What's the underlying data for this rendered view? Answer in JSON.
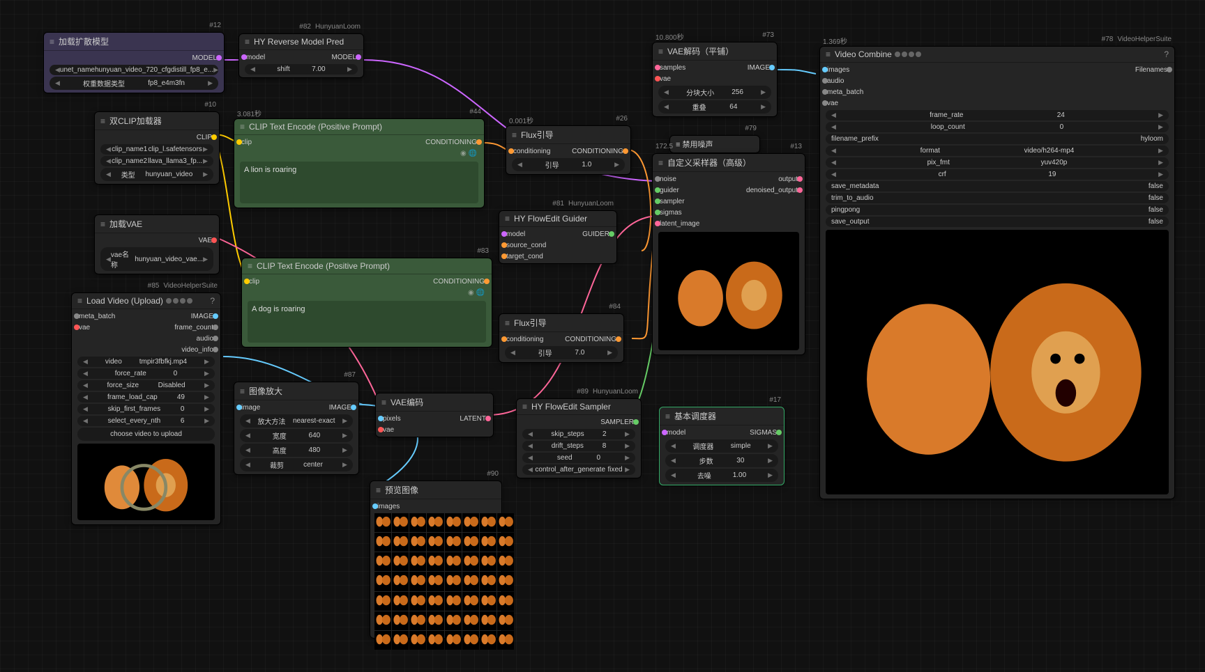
{
  "nodes": {
    "n12": {
      "id": "#12",
      "title": "加载扩散模型",
      "out": "MODEL",
      "w1_label": "unet_name",
      "w1_val": "hunyuan_video_720_cfgdistill_fp8_e...",
      "w2_label": "权重数据类型",
      "w2_val": "fp8_e4m3fn"
    },
    "n82": {
      "id": "#82",
      "tag": "HunyuanLoom",
      "title": "HY Reverse Model Pred",
      "in1": "model",
      "out1": "MODEL",
      "w1_label": "shift",
      "w1_val": "7.00"
    },
    "n73": {
      "id": "#73",
      "time": "10.800秒",
      "title": "VAE解码（平铺）",
      "in1": "samples",
      "in2": "vae",
      "out1": "IMAGE",
      "w1_label": "分块大小",
      "w1_val": "256",
      "w2_label": "重叠",
      "w2_val": "64"
    },
    "n78": {
      "id": "#78",
      "tag": "VideoHelperSuite",
      "time": "1.369秒",
      "title": "Video Combine",
      "in1": "images",
      "in2": "audio",
      "in3": "meta_batch",
      "in4": "vae",
      "out1": "Filenames",
      "rows": [
        {
          "label": "frame_rate",
          "val": "24"
        },
        {
          "label": "loop_count",
          "val": "0"
        },
        {
          "label": "filename_prefix",
          "val": "hyloom"
        },
        {
          "label": "format",
          "val": "video/h264-mp4"
        },
        {
          "label": "pix_fmt",
          "val": "yuv420p"
        },
        {
          "label": "crf",
          "val": "19"
        },
        {
          "label": "save_metadata",
          "val": "false"
        },
        {
          "label": "trim_to_audio",
          "val": "false"
        },
        {
          "label": "pingpong",
          "val": "false"
        },
        {
          "label": "save_output",
          "val": "false"
        }
      ]
    },
    "n10": {
      "id": "#10",
      "title": "双CLIP加载器",
      "out1": "CLIP",
      "rows": [
        {
          "label": "clip_name1",
          "val": "clip_l.safetensors"
        },
        {
          "label": "clip_name2",
          "val": "llava_llama3_fp..."
        },
        {
          "label": "类型",
          "val": "hunyuan_video"
        }
      ]
    },
    "n44": {
      "id": "#44",
      "time": "3.081秒",
      "title": "CLIP Text Encode (Positive Prompt)",
      "in1": "clip",
      "out1": "CONDITIONING",
      "text": "A lion is roaring"
    },
    "n83": {
      "id": "#83",
      "title": "CLIP Text Encode (Positive Prompt)",
      "in1": "clip",
      "out1": "CONDITIONING",
      "text": "A dog is roaring"
    },
    "n26": {
      "id": "#26",
      "time": "0.001秒",
      "title": "Flux引导",
      "in1": "conditioning",
      "out1": "CONDITIONING",
      "w1_label": "引导",
      "w1_val": "1.0"
    },
    "n84": {
      "id": "#84",
      "title": "Flux引导",
      "in1": "conditioning",
      "out1": "CONDITIONING",
      "w1_label": "引导",
      "w1_val": "7.0"
    },
    "n79": {
      "id": "#79",
      "title": "禁用噪声"
    },
    "n13": {
      "id": "#13",
      "time": "172.5",
      "title": "自定义采样器（高级）",
      "out1": "output",
      "out2": "denoised_output",
      "ins": [
        "noise",
        "guider",
        "sampler",
        "sigmas",
        "latent_image"
      ]
    },
    "n81": {
      "id": "#81",
      "tag": "HunyuanLoom",
      "title": "HY FlowEdit Guider",
      "out1": "GUIDER",
      "ins": [
        "model",
        "source_cond",
        "target_cond"
      ]
    },
    "n89": {
      "id": "#89",
      "tag": "HunyuanLoom",
      "title": "HY FlowEdit Sampler",
      "out1": "SAMPLER",
      "rows": [
        {
          "label": "skip_steps",
          "val": "2"
        },
        {
          "label": "drift_steps",
          "val": "8"
        },
        {
          "label": "seed",
          "val": "0"
        },
        {
          "label": "control_after_generate",
          "val": "fixed"
        }
      ]
    },
    "n17": {
      "id": "#17",
      "title": "基本调度器",
      "in1": "model",
      "out1": "SIGMAS",
      "rows": [
        {
          "label": "调度器",
          "val": "simple"
        },
        {
          "label": "步数",
          "val": "30"
        },
        {
          "label": "去噪",
          "val": "1.00"
        }
      ]
    },
    "vae_load": {
      "title": "加载VAE",
      "out1": "VAE",
      "w1_label": "vae名称",
      "w1_val": "hunyuan_video_vae..."
    },
    "n85": {
      "id": "#85",
      "tag": "VideoHelperSuite",
      "title": "Load Video (Upload)",
      "outs1": "meta_batch",
      "outs2": "vae",
      "routs": [
        "IMAGE",
        "frame_count",
        "audio",
        "video_info"
      ],
      "rows": [
        {
          "label": "video",
          "val": "tmpir3fbfkj.mp4"
        },
        {
          "label": "force_rate",
          "val": "0"
        },
        {
          "label": "force_size",
          "val": "Disabled"
        },
        {
          "label": "frame_load_cap",
          "val": "49"
        },
        {
          "label": "skip_first_frames",
          "val": "0"
        },
        {
          "label": "select_every_nth",
          "val": "6"
        }
      ],
      "choose": "choose video to upload"
    },
    "n87": {
      "id": "#87",
      "title": "图像放大",
      "in1": "image",
      "out1": "IMAGE",
      "rows": [
        {
          "label": "放大方法",
          "val": "nearest-exact"
        },
        {
          "label": "宽度",
          "val": "640"
        },
        {
          "label": "高度",
          "val": "480"
        },
        {
          "label": "裁剪",
          "val": "center"
        }
      ]
    },
    "n_vae_enc": {
      "title": "VAE编码",
      "in1": "pixels",
      "in2": "vae",
      "out1": "LATENT"
    },
    "n90": {
      "id": "#90",
      "title": "预览图像",
      "in1": "images"
    }
  }
}
